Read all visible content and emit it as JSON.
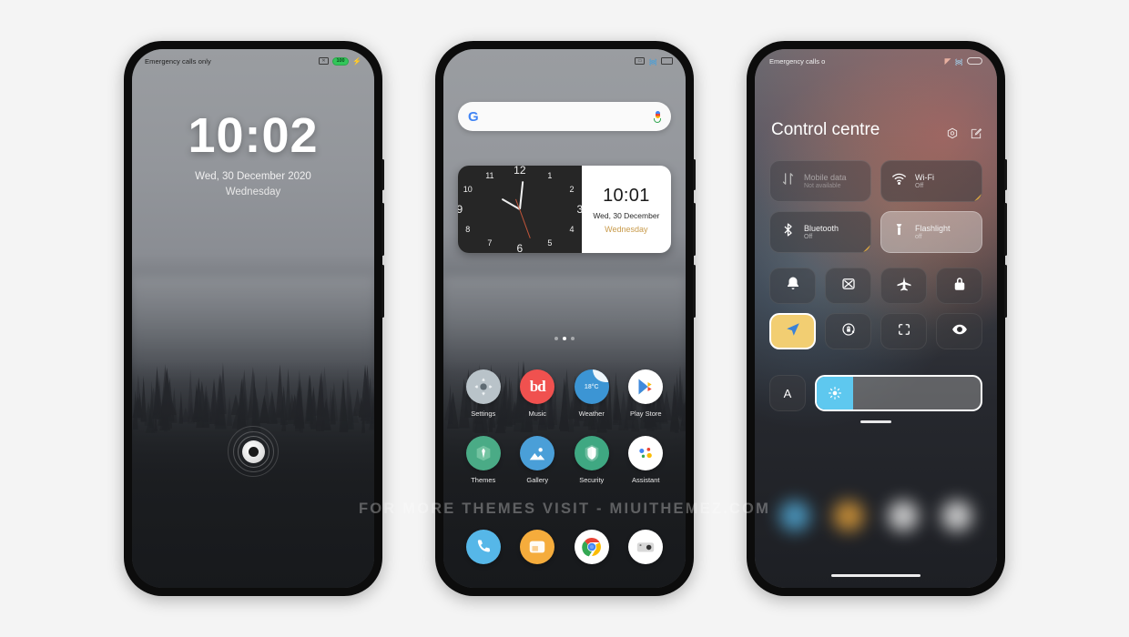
{
  "watermark": "FOR MORE THEMES VISIT - MIUITHEMEZ.COM",
  "lock_screen": {
    "status_left": "Emergency calls only",
    "battery_level": "100",
    "time": "10:02",
    "date": "Wed, 30 December 2020",
    "weekday": "Wednesday",
    "fingerprint_icon": "fingerprint-ring-icon",
    "sim_icon": "sim-off-icon",
    "charging_icon": "bolt-icon"
  },
  "home_screen": {
    "status_icons": [
      "screenshot-icon",
      "wifi-icon",
      "battery-icon"
    ],
    "search": {
      "logo": "google-g-icon",
      "mic_icon": "microphone-icon",
      "placeholder": ""
    },
    "widget": {
      "analog_numbers": [
        "1",
        "2",
        "3",
        "4",
        "5",
        "6",
        "7",
        "8",
        "9",
        "10",
        "11",
        "12"
      ],
      "hour_deg": 300,
      "minute_deg": 6,
      "second_deg": 160,
      "time": "10:01",
      "date": "Wed, 30 December",
      "weekday": "Wednesday",
      "weekday_color": "#c89a4a"
    },
    "page_dots": {
      "count": 3,
      "active": 1
    },
    "apps": [
      {
        "label": "Settings",
        "icon": "gear-icon",
        "color": "#b9c3c9"
      },
      {
        "label": "Music",
        "icon": "music-bd-icon",
        "color": "#f0514f"
      },
      {
        "label": "Weather",
        "icon": "weather-icon",
        "color": "#3c95d4",
        "temp": "18°C"
      },
      {
        "label": "Play Store",
        "icon": "play-store-icon",
        "color": "#ffffff"
      },
      {
        "label": "Themes",
        "icon": "themes-icon",
        "color": "#4aab86"
      },
      {
        "label": "Gallery",
        "icon": "gallery-icon",
        "color": "#4a9fd8"
      },
      {
        "label": "Security",
        "icon": "security-icon",
        "color": "#3fa882"
      },
      {
        "label": "Assistant",
        "icon": "assistant-icon",
        "color": "#ffffff"
      }
    ],
    "dock": [
      {
        "label": "Phone",
        "icon": "phone-icon",
        "color": "#56b7e8"
      },
      {
        "label": "Messages",
        "icon": "messages-icon",
        "color": "#f5ac3c"
      },
      {
        "label": "Chrome",
        "icon": "chrome-icon",
        "color": "#ffffff"
      },
      {
        "label": "Camera",
        "icon": "camera-icon",
        "color": "#ffffff"
      }
    ]
  },
  "control_centre": {
    "status_left": "Emergency calls o",
    "title": "Control centre",
    "action_icons": [
      "settings-gear-icon",
      "edit-icon"
    ],
    "tiles": [
      {
        "name": "Mobile data",
        "state": "Not available",
        "icon": "mobile-data-icon",
        "style": "dim",
        "corner": false
      },
      {
        "name": "Wi-Fi",
        "state": "Off",
        "icon": "wifi-icon",
        "style": "normal",
        "corner": true
      },
      {
        "name": "Bluetooth",
        "state": "Off",
        "icon": "bluetooth-icon",
        "style": "normal",
        "corner": true
      },
      {
        "name": "Flashlight",
        "state": "off",
        "icon": "flashlight-icon",
        "style": "light",
        "corner": false
      }
    ],
    "mini_toggles": [
      {
        "icon": "bell-icon",
        "active": false
      },
      {
        "icon": "screenshot-icon",
        "active": false
      },
      {
        "icon": "airplane-icon",
        "active": false
      },
      {
        "icon": "lock-icon",
        "active": false
      },
      {
        "icon": "location-icon",
        "active": true
      },
      {
        "icon": "rotation-lock-icon",
        "active": false
      },
      {
        "icon": "scan-icon",
        "active": false
      },
      {
        "icon": "eye-icon",
        "active": false
      }
    ],
    "brightness": {
      "auto_label": "A",
      "icon": "brightness-sun-icon",
      "value_percent": 22
    }
  }
}
